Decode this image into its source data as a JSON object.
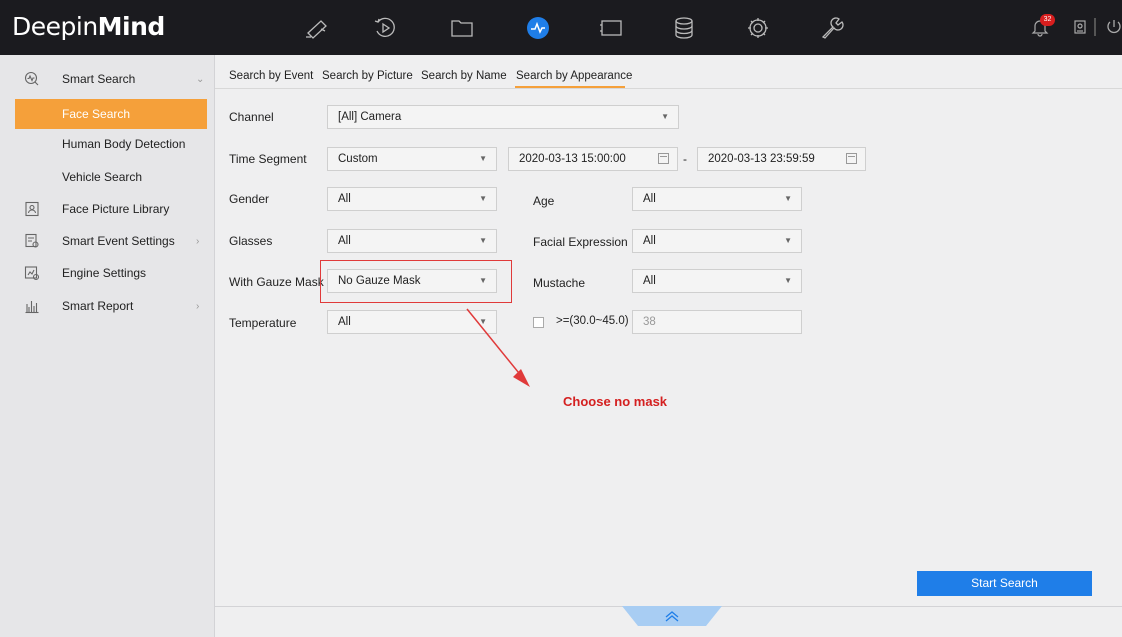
{
  "app": {
    "logo_light": "Deepin",
    "logo_bold": "Mind",
    "notification_count": "32"
  },
  "nav": [
    "camera-icon",
    "playback-icon",
    "folder-icon",
    "smart-search-icon",
    "display-icon",
    "storage-icon",
    "settings-icon",
    "maintenance-icon"
  ],
  "sidebar": {
    "smart_search": "Smart Search",
    "face_search": "Face Search",
    "human_body": "Human Body Detection",
    "vehicle": "Vehicle Search",
    "face_library": "Face Picture Library",
    "event_settings": "Smart Event Settings",
    "engine_settings": "Engine Settings",
    "smart_report": "Smart Report"
  },
  "tabs": {
    "event": "Search by Event",
    "picture": "Search by Picture",
    "name": "Search by Name",
    "appearance": "Search by Appearance"
  },
  "form": {
    "channel_label": "Channel",
    "channel_value": "[All] Camera",
    "time_label": "Time Segment",
    "time_value": "Custom",
    "start_time": "2020-03-13 15:00:00",
    "dash": "-",
    "end_time": "2020-03-13 23:59:59",
    "gender_label": "Gender",
    "gender_value": "All",
    "age_label": "Age",
    "age_value": "All",
    "glasses_label": "Glasses",
    "glasses_value": "All",
    "expression_label": "Facial Expression",
    "expression_value": "All",
    "mask_label": "With Gauze Mask",
    "mask_value": "No Gauze Mask",
    "mustache_label": "Mustache",
    "mustache_value": "All",
    "temp_label": "Temperature",
    "temp_value": "All",
    "temp_range": ">=(30.0~45.0)",
    "temp_threshold": "38"
  },
  "annotation": "Choose no mask",
  "start_search": "Start Search",
  "colors": {
    "accent": "#f5a03a",
    "primary": "#1f7ee8",
    "annotation": "#d42020"
  }
}
